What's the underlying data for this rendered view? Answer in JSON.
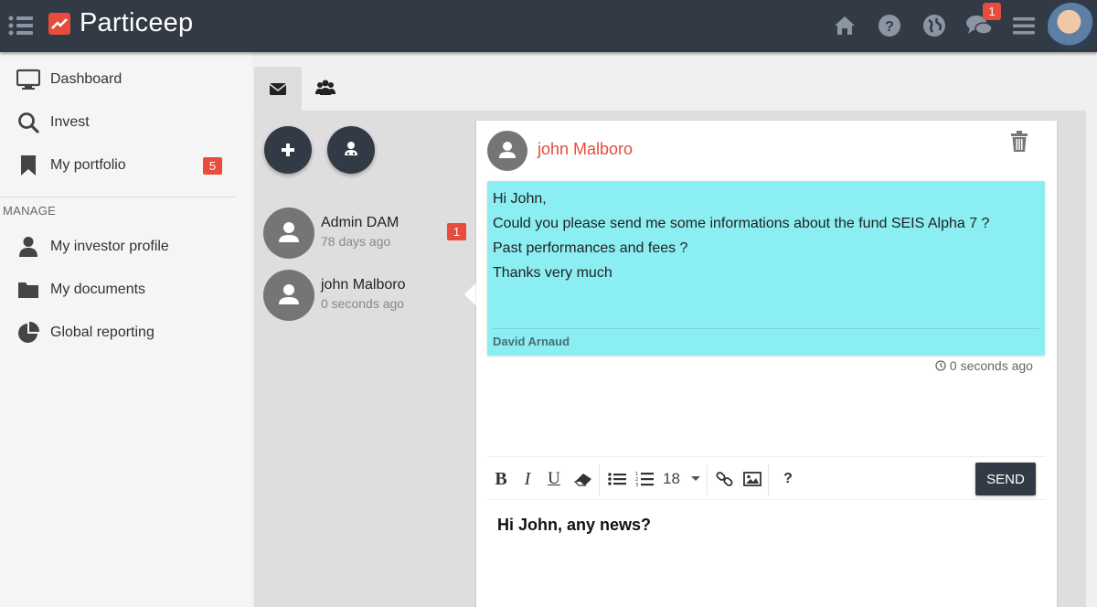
{
  "header": {
    "brand": "Particeep",
    "chat_badge": "1",
    "icons": [
      "menu-icon",
      "home-icon",
      "help-icon",
      "globe-icon",
      "chat-icon",
      "hamburger-icon"
    ]
  },
  "sidebar": {
    "items": [
      {
        "label": "Dashboard",
        "icon": "monitor-icon"
      },
      {
        "label": "Invest",
        "icon": "search-icon"
      },
      {
        "label": "My portfolio",
        "icon": "bookmark-icon",
        "badge": "5"
      }
    ],
    "section_label": "MANAGE",
    "manage_items": [
      {
        "label": "My investor profile",
        "icon": "user-icon"
      },
      {
        "label": "My documents",
        "icon": "folder-icon"
      },
      {
        "label": "Global reporting",
        "icon": "pie-chart-icon"
      }
    ]
  },
  "tabs": [
    {
      "icon": "envelope-icon",
      "active": true
    },
    {
      "icon": "users-icon",
      "active": false
    }
  ],
  "conversations": [
    {
      "name": "Admin DAM",
      "time": "78 days ago",
      "badge": "1"
    },
    {
      "name": "john Malboro",
      "time": "0 seconds ago"
    }
  ],
  "thread": {
    "name": "john Malboro",
    "message_lines": [
      "Hi John,",
      "Could you please send me some informations about the fund SEIS Alpha 7 ?",
      "Past performances and fees ?",
      "Thanks very much"
    ],
    "author": "David Arnaud",
    "time": "0 seconds ago"
  },
  "editor": {
    "font_size": "18",
    "help": "?",
    "send_label": "SEND",
    "text": "Hi John, any news?"
  },
  "colors": {
    "topbar": "#323a45",
    "accent_red": "#e74c3c",
    "bubble": "#8aeef3"
  }
}
